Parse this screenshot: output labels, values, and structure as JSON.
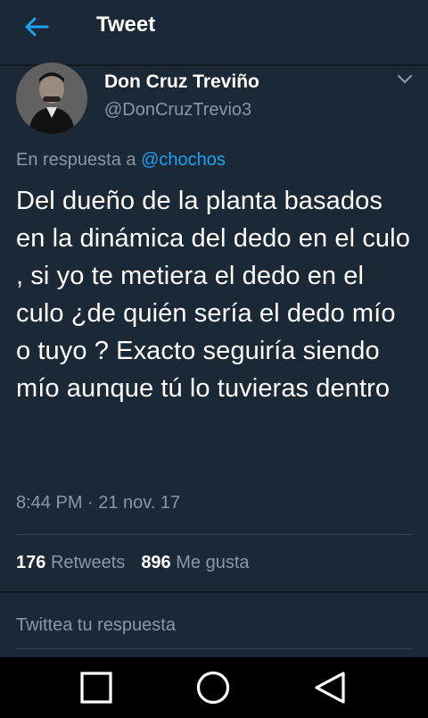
{
  "header": {
    "title": "Tweet",
    "back_icon": "arrow-left-icon"
  },
  "author": {
    "name": "Don Cruz Treviño",
    "handle": "@DonCruzTrevio3"
  },
  "reply_context": {
    "prefix": "En respuesta a",
    "mention": "@chochos"
  },
  "tweet": {
    "text": "Del dueño de la planta basados en la dinámica del dedo en el culo , si yo te metiera el dedo en el culo ¿de quién sería el dedo mío o tuyo ? Exacto seguiría siendo mío aunque tú lo tuvieras dentro",
    "timestamp": "8:44 PM · 21 nov. 17"
  },
  "stats": {
    "retweets_count": "176",
    "retweets_label": "Retweets",
    "likes_count": "896",
    "likes_label": "Me gusta"
  },
  "reply": {
    "placeholder": "Twittea tu respuesta"
  },
  "navbar": {
    "recents_icon": "square-icon",
    "home_icon": "circle-icon",
    "back_icon": "triangle-back-icon"
  },
  "colors": {
    "background": "#1b2836",
    "accent": "#1da1f2",
    "muted": "#8899a6"
  }
}
